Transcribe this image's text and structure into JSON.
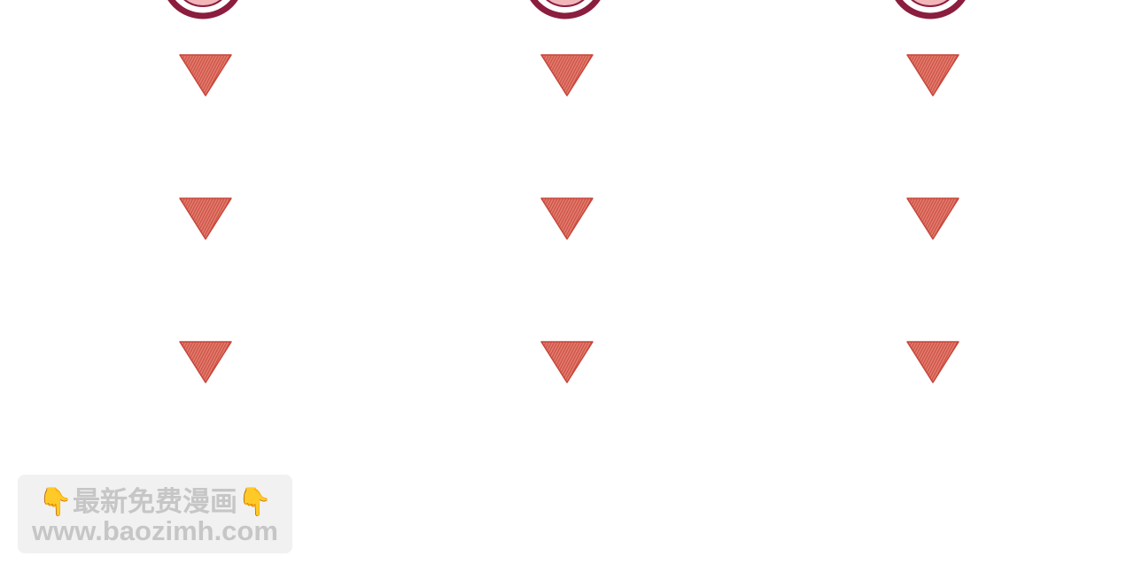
{
  "colors": {
    "background": "#ffffff",
    "badge_ring": "#8b1d3f",
    "badge_inner": "#f2b5b8",
    "arrow_fill": "#e07a6c",
    "arrow_hatch": "#c8453a",
    "watermark_text": "#c6c6c6"
  },
  "icons": {
    "badge": "circle-badge-icon",
    "arrow": "down-arrow-triangle-icon",
    "hand": "pointing-down-hand-icon"
  },
  "watermark": {
    "hand_left": "👇",
    "title": "最新免费漫画",
    "hand_right": "👇",
    "url": "www.baozimh.com"
  }
}
